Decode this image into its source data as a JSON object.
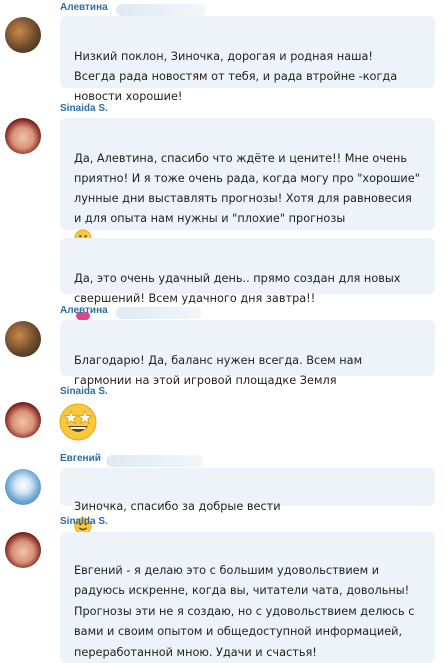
{
  "messages": [
    {
      "sender": "Алевтина",
      "text": "Низкий поклон, Зиночка, дорогая и родная наша!\nВсегда рада новостям от тебя, и рада втройне -когда новости хорошие!"
    },
    {
      "sender": "Sinaida S.",
      "bubbles": [
        "Да, Алевтина, спасибо что ждёте и цените!! Мне очень приятно! И я тоже очень рада, когда могу про \"хорошие\" лунные дни выставлять прогнозы! Хотя для равновесия и для опыта нам нужны и \"плохие\" прогнозы",
        "Да, это очень удачный день.. прямо создан для новых свершений! Всем удачного дня завтра!!"
      ]
    },
    {
      "sender": "Алевтина",
      "text": "Благодарю! Да, баланс нужен  всегда. Всем нам гармонии на этой игровой площадке Земля"
    },
    {
      "sender": "Sinaida S.",
      "emoji": "star-struck-emoji"
    },
    {
      "sender": "Евгений",
      "text": "Зиночка, спасибо за добрые вести"
    },
    {
      "sender": "Sinaida S.",
      "text": "Евгений - я делаю это с большим удовольствием и радуюсь искренне, когда вы, читатели чата, довольны! Прогнозы эти не я создаю, но с удовольствием делюсь с вами и своим опытом и общедоступной информацией, переработанной мною. Удачи и счастья!"
    }
  ],
  "colors": {
    "sender_name": "#2e6da4",
    "bubble_bg": "#edf3f8"
  }
}
